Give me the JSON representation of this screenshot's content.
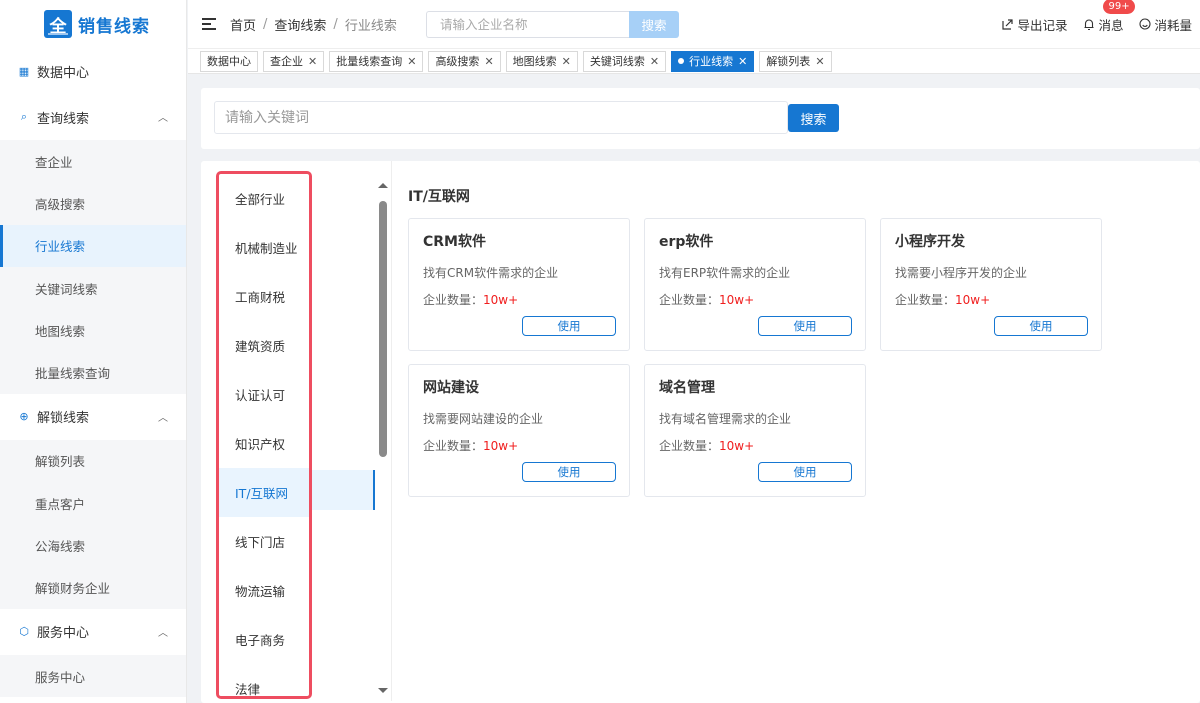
{
  "app": {
    "logo_char": "全",
    "title": "销售线索"
  },
  "sidebar": {
    "groups": [
      {
        "label": "数据中心",
        "items": []
      },
      {
        "label": "查询线索",
        "items": [
          "查企业",
          "高级搜索",
          "行业线索",
          "关键词线索",
          "地图线索",
          "批量线索查询"
        ]
      },
      {
        "label": "解锁线索",
        "items": [
          "解锁列表",
          "重点客户",
          "公海线索",
          "解锁财务企业"
        ]
      },
      {
        "label": "服务中心",
        "items": [
          "服务中心"
        ]
      }
    ],
    "active_item": "行业线索"
  },
  "breadcrumb": {
    "items": [
      "首页",
      "查询线索",
      "行业线索"
    ],
    "sep": "/"
  },
  "topsearch": {
    "placeholder": "请输入企业名称",
    "button": "搜索"
  },
  "topright": {
    "export": "导出记录",
    "messages": "消息",
    "badge": "99+",
    "usage": "消耗量"
  },
  "tabs": [
    {
      "label": "数据中心",
      "closable": false,
      "active": false
    },
    {
      "label": "查企业",
      "closable": true,
      "active": false
    },
    {
      "label": "批量线索查询",
      "closable": true,
      "active": false
    },
    {
      "label": "高级搜索",
      "closable": true,
      "active": false
    },
    {
      "label": "地图线索",
      "closable": true,
      "active": false
    },
    {
      "label": "关键词线索",
      "closable": true,
      "active": false
    },
    {
      "label": "行业线索",
      "closable": true,
      "active": true
    },
    {
      "label": "解锁列表",
      "closable": true,
      "active": false
    }
  ],
  "keyword": {
    "placeholder": "请输入关键词",
    "button": "搜索"
  },
  "industries": [
    "全部行业",
    "机械制造业",
    "工商财税",
    "建筑资质",
    "认证认可",
    "知识产权",
    "IT/互联网",
    "线下门店",
    "物流运输",
    "电子商务",
    "法律"
  ],
  "active_industry": "IT/互联网",
  "category_title": "IT/互联网",
  "card_count_label": "企业数量：",
  "use_label": "使用",
  "cards": [
    {
      "title": "CRM软件",
      "desc": "找有CRM软件需求的企业",
      "count": "10w+"
    },
    {
      "title": "erp软件",
      "desc": "找有ERP软件需求的企业",
      "count": "10w+"
    },
    {
      "title": "小程序开发",
      "desc": "找需要小程序开发的企业",
      "count": "10w+"
    },
    {
      "title": "网站建设",
      "desc": "找需要网站建设的企业",
      "count": "10w+"
    },
    {
      "title": "域名管理",
      "desc": "找有域名管理需求的企业",
      "count": "10w+"
    }
  ],
  "colors": {
    "primary": "#1677d2",
    "highlight_border": "#ee4d60",
    "count_red": "#f01e1e"
  }
}
